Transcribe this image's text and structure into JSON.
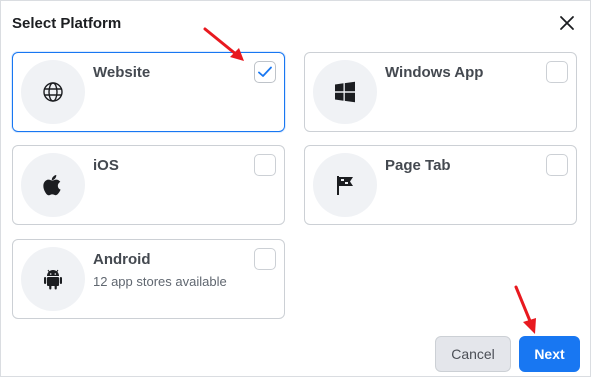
{
  "dialog": {
    "title": "Select Platform",
    "close_icon": "close-icon"
  },
  "platforms": [
    {
      "label": "Website",
      "subtitle": "",
      "icon": "globe-icon",
      "selected": true
    },
    {
      "label": "Windows App",
      "subtitle": "",
      "icon": "windows-icon",
      "selected": false
    },
    {
      "label": "iOS",
      "subtitle": "",
      "icon": "apple-icon",
      "selected": false
    },
    {
      "label": "Page Tab",
      "subtitle": "",
      "icon": "flag-icon",
      "selected": false
    },
    {
      "label": "Android",
      "subtitle": "12 app stores available",
      "icon": "android-icon",
      "selected": false
    }
  ],
  "footer": {
    "cancel_label": "Cancel",
    "next_label": "Next"
  },
  "colors": {
    "accent": "#1877f2",
    "annotation_arrow": "#e8191f"
  }
}
